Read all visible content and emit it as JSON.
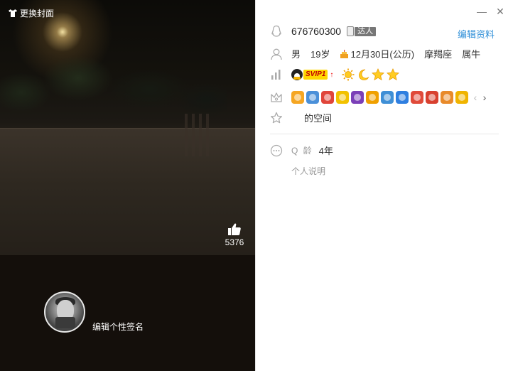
{
  "cover": {
    "change_cover_label": "更换封面",
    "like_count": "5376",
    "signature_label": "编辑个性签名"
  },
  "window": {
    "minimize_glyph": "—",
    "close_glyph": "✕"
  },
  "profile": {
    "qq_number": "676760300",
    "talent_label": "达人",
    "edit_label": "编辑资料",
    "gender": "男",
    "age": "19岁",
    "birthday": "12月30日(公历)",
    "zodiac": "摩羯座",
    "chinese_zodiac": "属牛",
    "vip_label": "SVIP1",
    "vip_arrow": "↑",
    "space_label": "的空间",
    "qage_label": "Q 龄",
    "qage_value": "4年",
    "personal_desc": "个人说明"
  },
  "level_icons": [
    "sun-icon",
    "moon-icon",
    "star-icon",
    "star-icon"
  ],
  "service_icons": [
    {
      "name": "service-icon-1",
      "color": "#f5a623"
    },
    {
      "name": "service-icon-2",
      "color": "#4a90d9"
    },
    {
      "name": "service-icon-3",
      "color": "#e0453a"
    },
    {
      "name": "service-icon-4",
      "color": "#f2c200"
    },
    {
      "name": "service-icon-5",
      "color": "#7b3fb8"
    },
    {
      "name": "service-icon-6",
      "color": "#f0a000"
    },
    {
      "name": "service-icon-7",
      "color": "#3f8fd6"
    },
    {
      "name": "service-icon-8",
      "color": "#2f7fe0"
    },
    {
      "name": "service-icon-9",
      "color": "#e04a3a"
    },
    {
      "name": "service-icon-10",
      "color": "#d8402f"
    },
    {
      "name": "service-icon-11",
      "color": "#e88a2a"
    },
    {
      "name": "service-icon-12",
      "color": "#f0b400"
    }
  ],
  "colors": {
    "accent_link": "#2f8fd8",
    "cover_background": "#140f0b",
    "muted_text": "#999999"
  }
}
